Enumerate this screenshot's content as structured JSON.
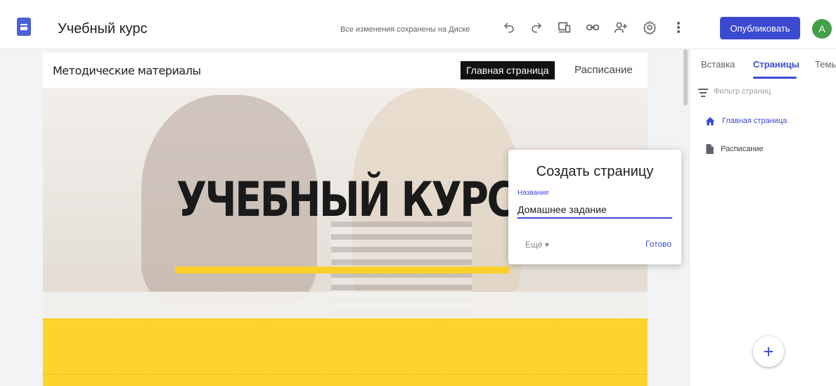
{
  "app": {
    "title": "Учебный курс",
    "save_status": "Все изменения сохранены на Диске"
  },
  "toolbar": {
    "publish_label": "Опубликовать",
    "avatar_letter": "A",
    "icons": [
      "undo-icon",
      "redo-icon",
      "preview-icon",
      "link-icon",
      "share-icon",
      "settings-icon",
      "more-vert-icon"
    ]
  },
  "site": {
    "name": "Методические материалы",
    "nav": [
      {
        "label": "Главная страница",
        "active": true
      },
      {
        "label": "Расписание",
        "active": false
      }
    ],
    "hero_title": "УЧЕБНЫЙ КУРС"
  },
  "panel": {
    "tabs": [
      {
        "label": "Вставка"
      },
      {
        "label": "Страницы",
        "active": true
      },
      {
        "label": "Темы"
      }
    ],
    "filter_placeholder": "Фильтр страниц",
    "pages": [
      {
        "label": "Главная страница",
        "icon": "home-icon"
      },
      {
        "label": "Расписание",
        "icon": "page-icon"
      }
    ],
    "fab": "+"
  },
  "dialog": {
    "title": "Создать страницу",
    "field_label": "Название",
    "field_value": "Домашнее задание",
    "more_label": "Ещё ▾",
    "done_label": "Готово"
  },
  "colors": {
    "accent": "#3b4ad1",
    "hero_underline": "#fbd02b",
    "band": "#fdd42e"
  }
}
